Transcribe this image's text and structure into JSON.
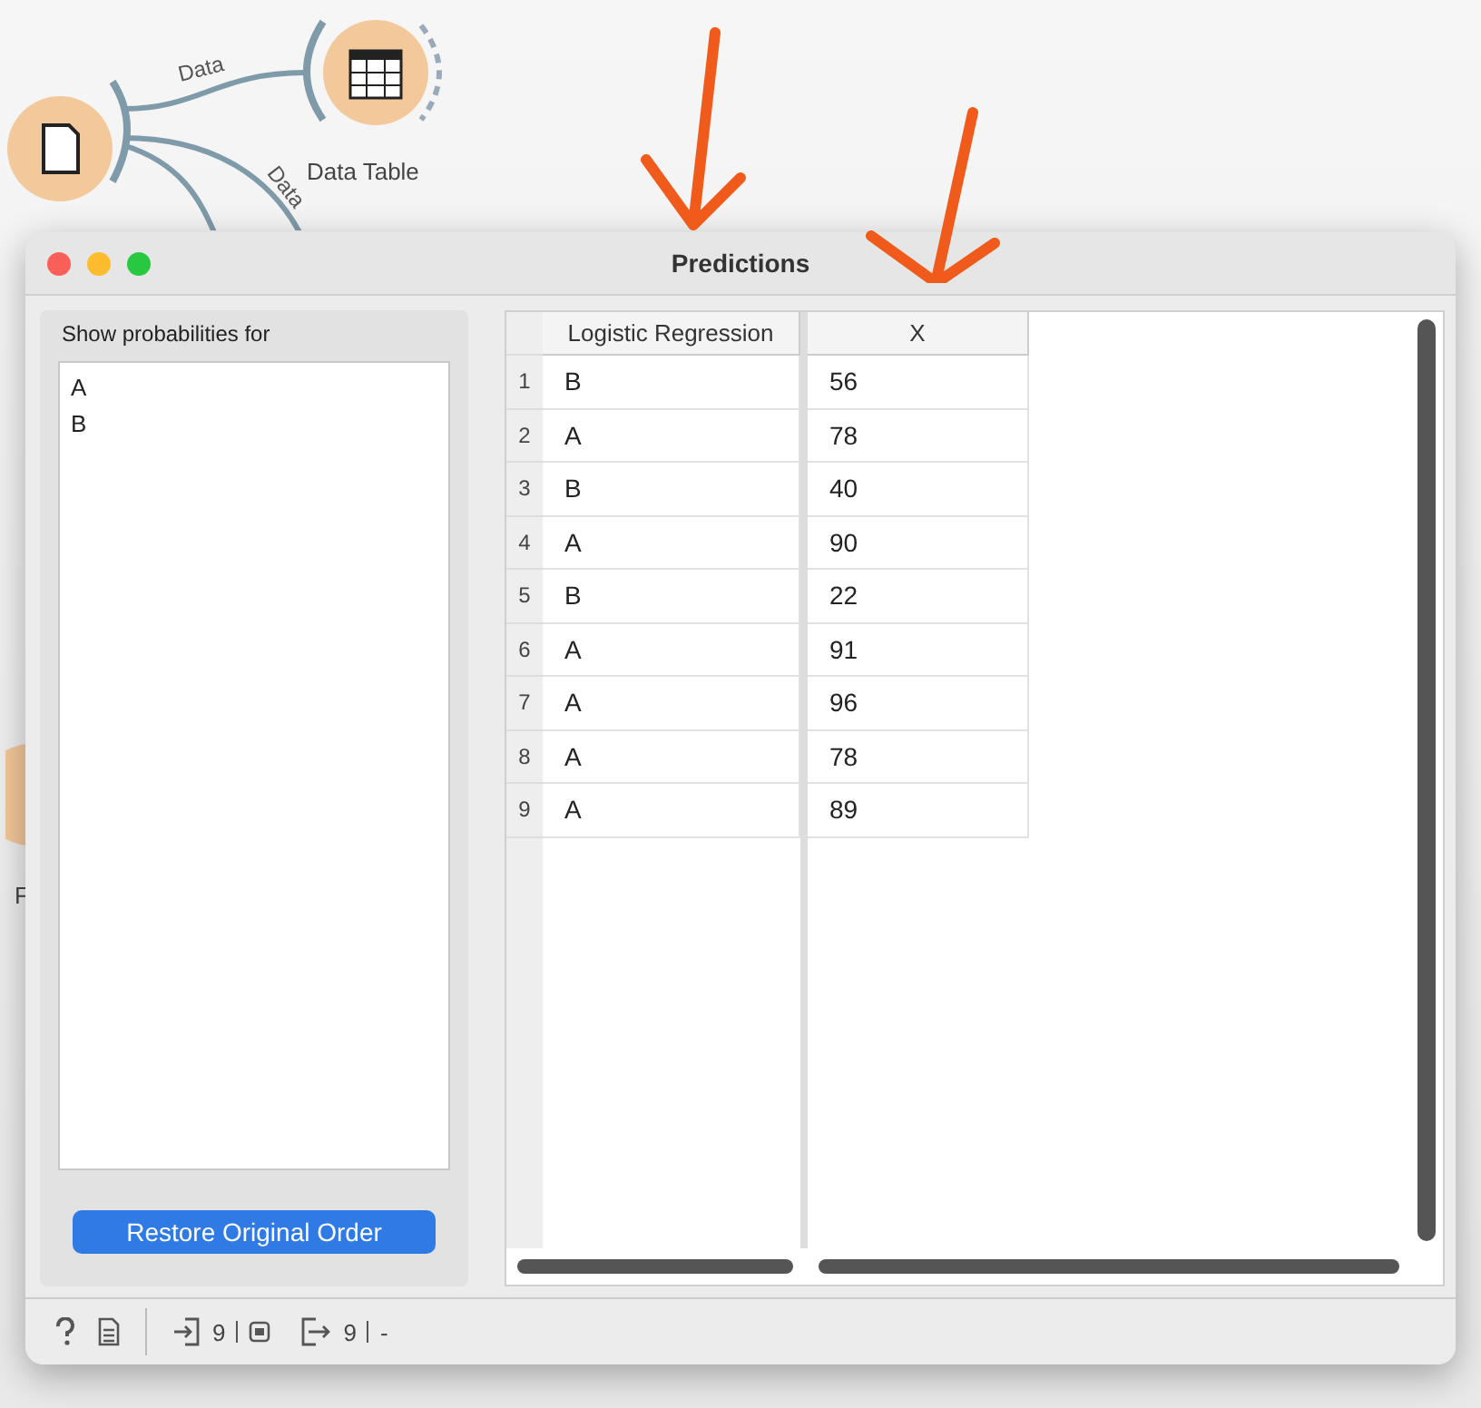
{
  "canvas": {
    "links": [
      {
        "label": "Data"
      },
      {
        "label": "Data"
      }
    ],
    "nodes": [
      {
        "kind": "table",
        "label": "Data Table"
      },
      {
        "kind": "partial",
        "label": "F"
      }
    ]
  },
  "window": {
    "title": "Predictions"
  },
  "probabilities": {
    "label": "Show probabilities for",
    "items": [
      {
        "label": "A",
        "selected": false
      },
      {
        "label": "B",
        "selected": false
      }
    ],
    "button": "Restore Original Order"
  },
  "table": {
    "columns": [
      "Logistic Regression",
      "X"
    ],
    "rows": [
      {
        "index": "1",
        "cells": [
          "B",
          "56"
        ]
      },
      {
        "index": "2",
        "cells": [
          "A",
          "78"
        ]
      },
      {
        "index": "3",
        "cells": [
          "B",
          "40"
        ]
      },
      {
        "index": "4",
        "cells": [
          "A",
          "90"
        ]
      },
      {
        "index": "5",
        "cells": [
          "B",
          "22"
        ]
      },
      {
        "index": "6",
        "cells": [
          "A",
          "91"
        ]
      },
      {
        "index": "7",
        "cells": [
          "A",
          "96"
        ]
      },
      {
        "index": "8",
        "cells": [
          "A",
          "78"
        ]
      },
      {
        "index": "9",
        "cells": [
          "A",
          "89"
        ]
      }
    ]
  },
  "status_bar": {
    "input_count": "9",
    "output_count": "9",
    "output_extra": "-"
  }
}
